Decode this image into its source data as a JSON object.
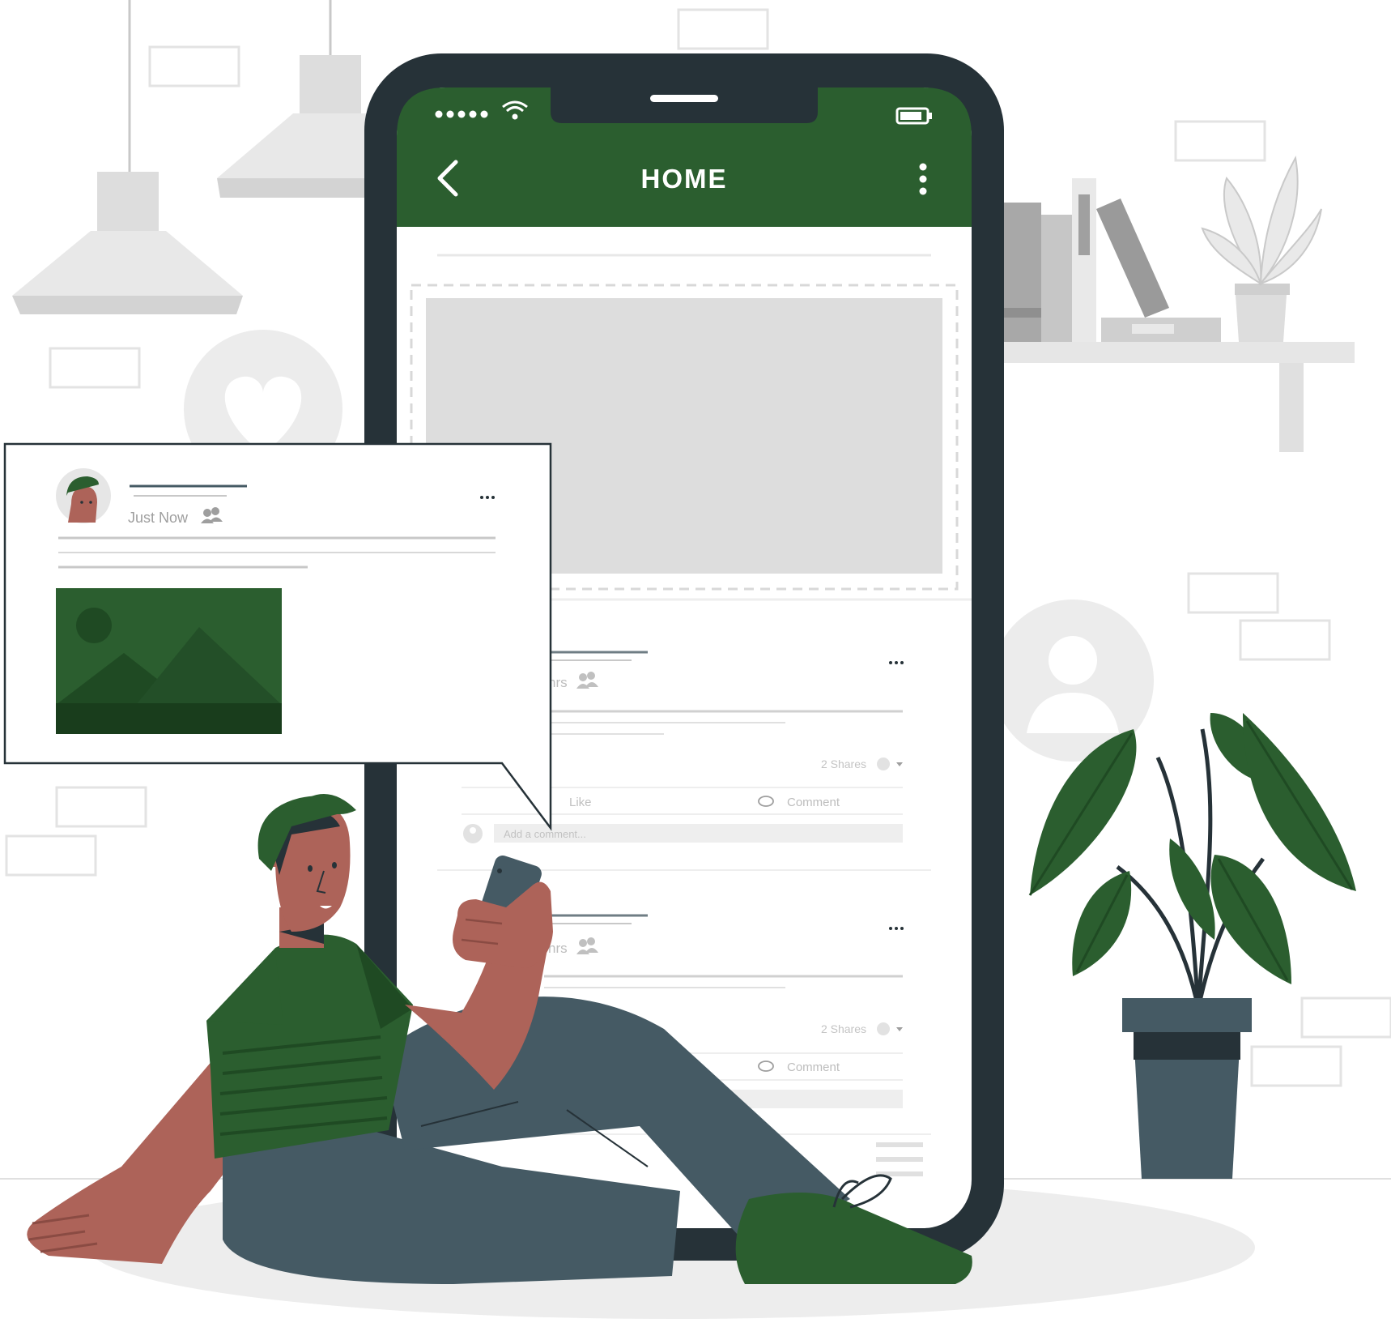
{
  "colors": {
    "accent": "#2b5e2f",
    "accent_dark": "#1f4a23",
    "phone_frame": "#263238",
    "skin": "#ad6359",
    "pants": "#455a64",
    "light_gray": "#e6e6e6",
    "mid_gray": "#c8c8c8"
  },
  "phone": {
    "header_title": "HOME",
    "status_bar": {
      "icons": [
        "signal-dots-icon",
        "wifi-icon",
        "battery-icon"
      ]
    },
    "nav": {
      "back_icon": "chevron-left-icon",
      "menu_icon": "kebab-menu-icon"
    },
    "posts": [
      {
        "time": "hrs",
        "shares": "2 Shares",
        "like_label": "Like",
        "comment_label": "Comment",
        "comment_placeholder": "Add a comment..."
      },
      {
        "time": "hrs",
        "shares": "2 Shares",
        "comment_label": "Comment"
      }
    ]
  },
  "popup_post": {
    "time": "Just Now",
    "menu_icon": "more-dots-icon",
    "image_icon": "landscape-image-icon"
  }
}
